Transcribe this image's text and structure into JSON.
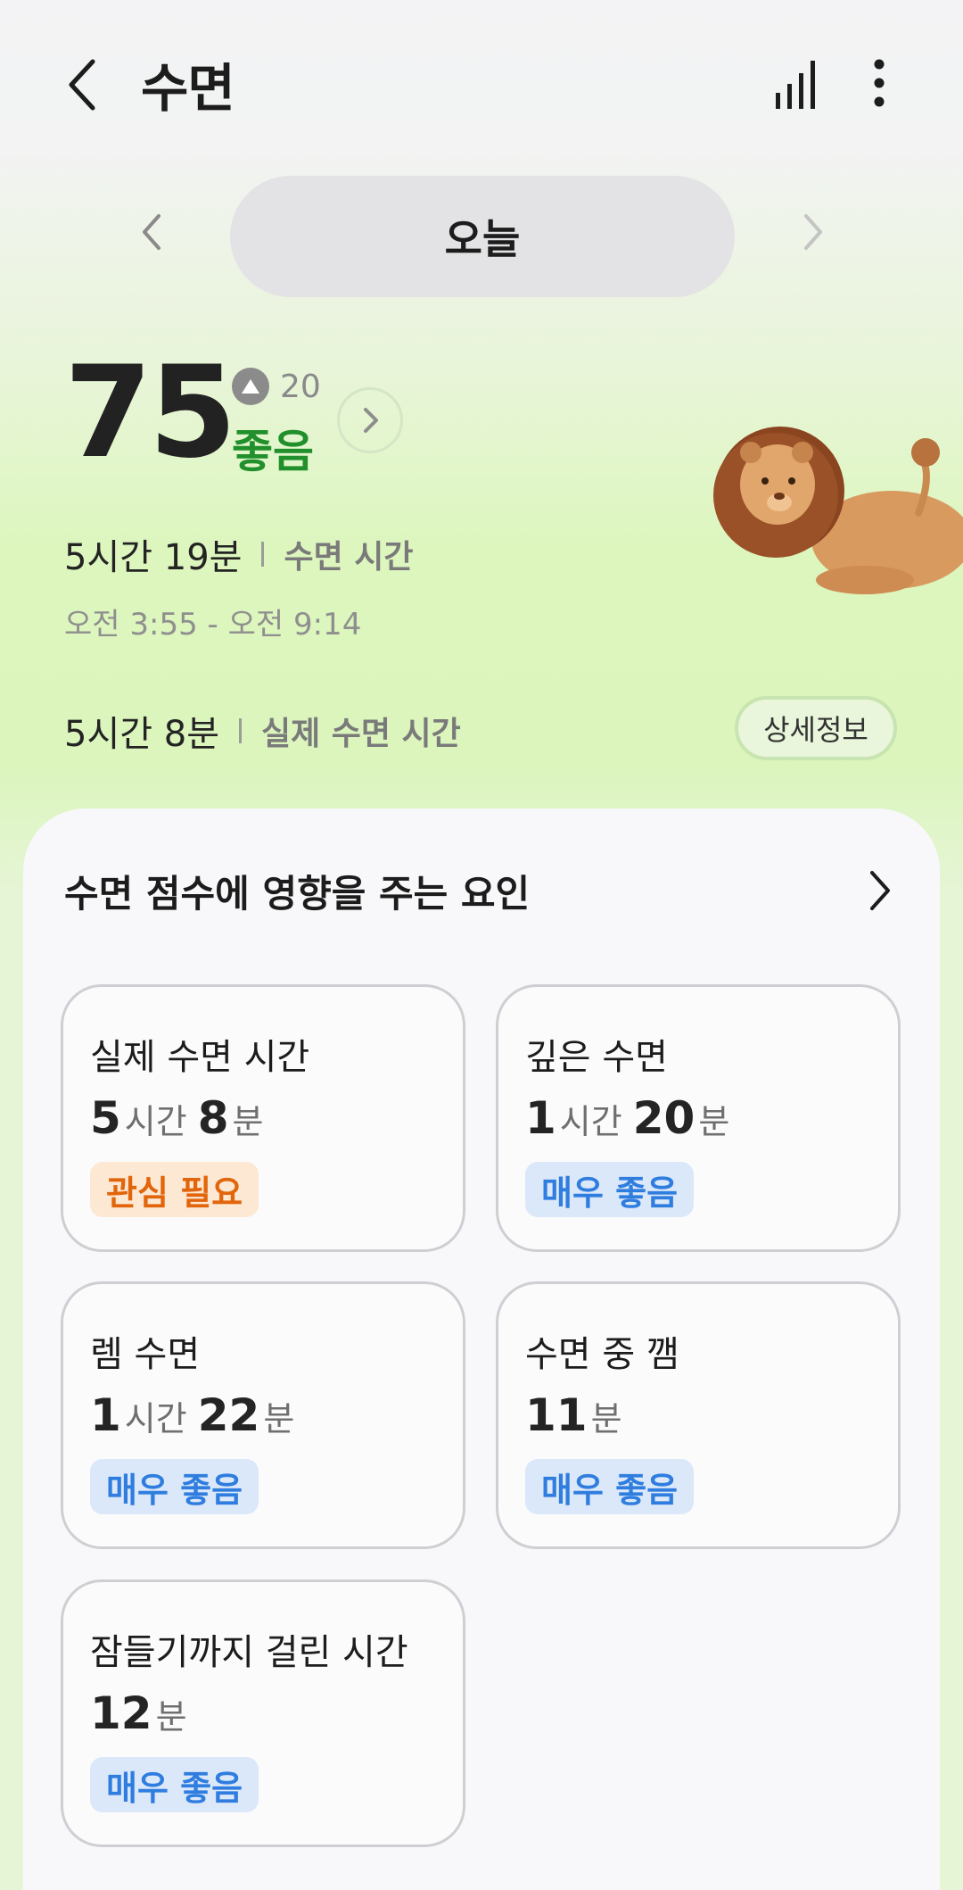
{
  "header": {
    "title": "수면"
  },
  "date_nav": {
    "label": "오늘"
  },
  "score": {
    "value": "75",
    "delta": "20",
    "grade": "좋음"
  },
  "sleep": {
    "total_duration": "5시간 19분",
    "total_label": "수면 시간",
    "time_range": "오전 3:55 - 오전 9:14",
    "actual_duration": "5시간 8분",
    "actual_label": "실제 수면 시간",
    "detail_button": "상세정보"
  },
  "factors": {
    "title": "수면 점수에 영향을 주는 요인",
    "items": [
      {
        "title": "실제 수면 시간",
        "parts": [
          {
            "num": "5",
            "unit": "시간"
          },
          {
            "num": "8",
            "unit": "분"
          }
        ],
        "badge": "관심 필요",
        "badge_type": "warn"
      },
      {
        "title": "깊은 수면",
        "parts": [
          {
            "num": "1",
            "unit": "시간"
          },
          {
            "num": "20",
            "unit": "분"
          }
        ],
        "badge": "매우 좋음",
        "badge_type": "good"
      },
      {
        "title": "렘 수면",
        "parts": [
          {
            "num": "1",
            "unit": "시간"
          },
          {
            "num": "22",
            "unit": "분"
          }
        ],
        "badge": "매우 좋음",
        "badge_type": "good"
      },
      {
        "title": "수면 중 깸",
        "parts": [
          {
            "num": "11",
            "unit": "분"
          }
        ],
        "badge": "매우 좋음",
        "badge_type": "good"
      },
      {
        "title": "잠들기까지 걸린 시간",
        "parts": [
          {
            "num": "12",
            "unit": "분"
          }
        ],
        "badge": "매우 좋음",
        "badge_type": "good"
      }
    ]
  },
  "colors": {
    "grade_green": "#21902c",
    "warn_orange": "#e2650c",
    "good_blue": "#2f7ddf"
  },
  "icons": {
    "back": "chevron-left-icon",
    "chart": "signal-bars-icon",
    "more": "more-vertical-icon",
    "mascot": "lion-illustration"
  }
}
